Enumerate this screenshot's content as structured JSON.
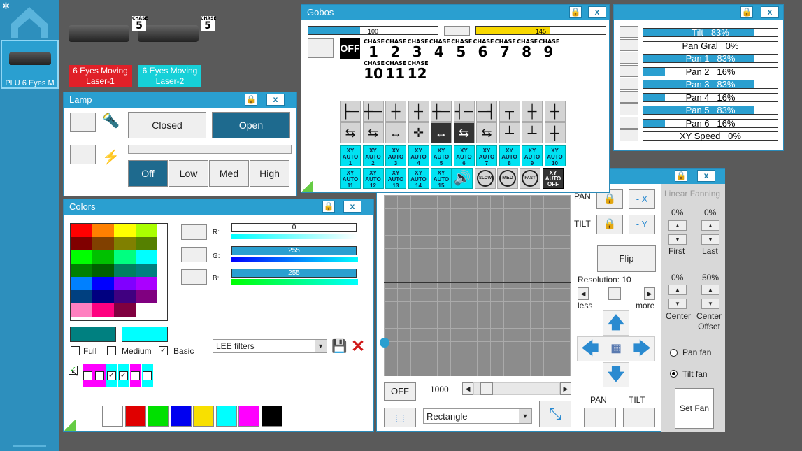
{
  "sidebar": {
    "fixture_label": "PLU 6 Eyes M"
  },
  "fixtures": {
    "chase_small": "CHASE",
    "chase_num": "5",
    "laser1": "6 Eyes Moving\nLaser-1",
    "laser2": "6 Eyes Moving\nLaser-2",
    "laser1_color": "#e02028",
    "laser2_color": "#16d0d8"
  },
  "gobos": {
    "title": "Gobos",
    "slider1": "100",
    "slider2": "145",
    "off_label": "OFF",
    "chase_label": "CHASE",
    "chases": [
      "1",
      "2",
      "3",
      "4",
      "5",
      "6",
      "7",
      "8",
      "9",
      "10",
      "11",
      "12"
    ],
    "gobo_row1": [
      "├─",
      "┼─",
      "┼",
      "┼",
      "┼─",
      "┤─",
      "─┤",
      "┬",
      "┼",
      "┼"
    ],
    "gobo_row2": [
      "⇆",
      "⇆",
      "↔",
      "✛",
      "↔",
      "⇆",
      "⇆",
      "┴",
      "┴",
      "┼"
    ],
    "xy_label": "XY",
    "auto_label": "AUTO",
    "xy_nums": [
      "1",
      "2",
      "3",
      "4",
      "5",
      "6",
      "7",
      "8",
      "9",
      "10",
      "11",
      "12",
      "13",
      "14",
      "15"
    ],
    "speed_icons": [
      "speaker-icon",
      "slow-icon",
      "med-icon",
      "fast-icon",
      "xy-auto-off-icon"
    ],
    "slow": "SLOW",
    "med": "MED",
    "fast": "FAST",
    "off": "OFF"
  },
  "channels": {
    "items": [
      {
        "label": "Tilt",
        "value": "83%",
        "level": 0.83
      },
      {
        "label": "Pan Gral",
        "value": "0%",
        "level": 0
      },
      {
        "label": "Pan 1",
        "value": "83%",
        "level": 0.83
      },
      {
        "label": "Pan 2",
        "value": "16%",
        "level": 0.16
      },
      {
        "label": "Pan 3",
        "value": "83%",
        "level": 0.83
      },
      {
        "label": "Pan 4",
        "value": "16%",
        "level": 0.16
      },
      {
        "label": "Pan 5",
        "value": "83%",
        "level": 0.83
      },
      {
        "label": "Pan 6",
        "value": "16%",
        "level": 0.16
      },
      {
        "label": "XY Speed",
        "value": "0%",
        "level": 0
      }
    ]
  },
  "lamp": {
    "title": "Lamp",
    "closed": "Closed",
    "open": "Open",
    "off": "Off",
    "low": "Low",
    "med": "Med",
    "high": "High"
  },
  "colors": {
    "title": "Colors",
    "r_label": "R:",
    "g_label": "G:",
    "b_label": "B:",
    "r_value": "0",
    "g_value": "255",
    "b_value": "255",
    "full": "Full",
    "medium": "Medium",
    "basic": "Basic",
    "filter": "LEE filters",
    "palette": [
      "#ff0000",
      "#ff8000",
      "#ffff00",
      "#aaff00",
      "#800000",
      "#804000",
      "#808000",
      "#558000",
      "#00ff00",
      "#00c000",
      "#00ff80",
      "#00ffff",
      "#008000",
      "#006000",
      "#008060",
      "#008080",
      "#0080ff",
      "#0000ff",
      "#8000ff",
      "#aa00ff",
      "#004080",
      "#000080",
      "#400080",
      "#800080",
      "#ff80c0",
      "#ff0080",
      "#800040",
      "#ffffff"
    ],
    "bottom_swatches": [
      "#ffffff",
      "#e00000",
      "#00e000",
      "#0000f0",
      "#f8e000",
      "#00ffff",
      "#ff00ff",
      "#000000"
    ],
    "current1": "#008080",
    "current2": "#00ffff"
  },
  "xy": {
    "pan": "PAN",
    "tilt": "TILT",
    "minus_x": "- X",
    "minus_y": "- Y",
    "flip": "Flip",
    "resolution": "Resolution: 10",
    "less": "less",
    "more": "more",
    "off": "OFF",
    "speed": "1000",
    "shape": "Rectangle",
    "pan_label": "PAN",
    "tilt_label": "TILT"
  },
  "fan": {
    "title": "Linear Fanning",
    "first_pct": "0%",
    "last_pct": "0%",
    "center_pct": "0%",
    "offset_pct": "50%",
    "first": "First",
    "last": "Last",
    "center": "Center",
    "center_offset": "Center\nOffset",
    "pan_fan": "Pan fan",
    "tilt_fan": "Tilt fan",
    "set_fan": "Set Fan"
  }
}
